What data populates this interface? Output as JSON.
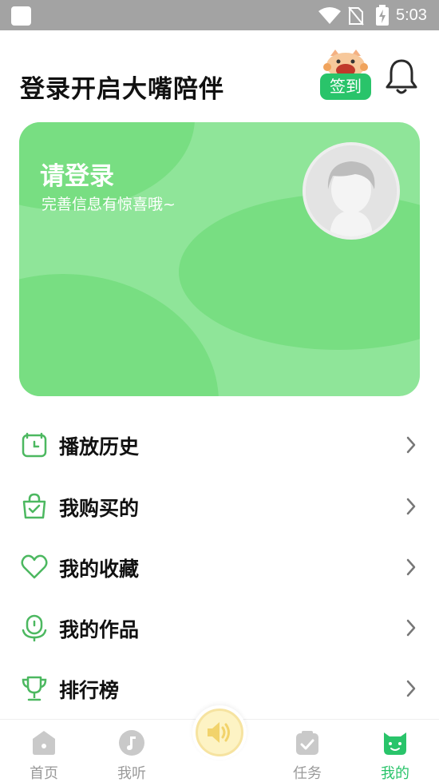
{
  "status_bar": {
    "time": "5:03"
  },
  "header": {
    "title": "登录开启大嘴陪伴",
    "checkin_label": "签到"
  },
  "login_card": {
    "title": "请登录",
    "subtitle": "完善信息有惊喜哦~"
  },
  "menu": [
    {
      "label": "播放历史",
      "icon": "clock-icon"
    },
    {
      "label": "我购买的",
      "icon": "shopping-bag-icon"
    },
    {
      "label": "我的收藏",
      "icon": "heart-icon"
    },
    {
      "label": "我的作品",
      "icon": "microphone-icon"
    },
    {
      "label": "排行榜",
      "icon": "trophy-icon"
    }
  ],
  "tabbar": {
    "tabs": [
      {
        "label": "首页",
        "icon": "home-icon",
        "active": false
      },
      {
        "label": "我听",
        "icon": "music-note-icon",
        "active": false
      },
      {
        "label": "任务",
        "icon": "task-check-icon",
        "active": false
      },
      {
        "label": "我的",
        "icon": "profile-cat-icon",
        "active": true
      }
    ],
    "center_icon": "speaker-icon"
  },
  "colors": {
    "accent": "#29c46a",
    "card": "#8fe599",
    "card_blob": "#78de82",
    "icon_green": "#4cb860",
    "tab_inactive": "#9a9a9a"
  }
}
